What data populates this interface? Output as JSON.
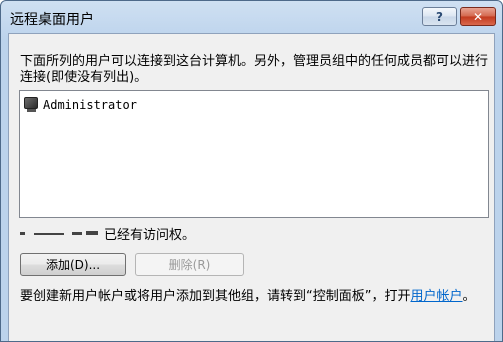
{
  "window": {
    "title": "远程桌面用户",
    "help_label": "?",
    "close_label": "✕"
  },
  "description": "下面所列的用户可以连接到这台计算机。另外，管理员组中的任何成员都可以进行连接(即使没有列出)。",
  "user_list": {
    "items": [
      {
        "label": "Administrator",
        "icon": "user-computer-icon"
      }
    ]
  },
  "access": {
    "text": "已经有访问权。"
  },
  "buttons": {
    "add_label": "添加(D)...",
    "delete_label": "删除(R)"
  },
  "footer": {
    "text_before": "要创建新用户帐户或将用户添加到其他组，请转到“控制面板”，打开",
    "link_text": "用户帐户",
    "text_after": "。"
  },
  "colors": {
    "accent_link": "#0066cc",
    "close_red": "#c2391d",
    "frame_blue": "#bcd3ec"
  }
}
